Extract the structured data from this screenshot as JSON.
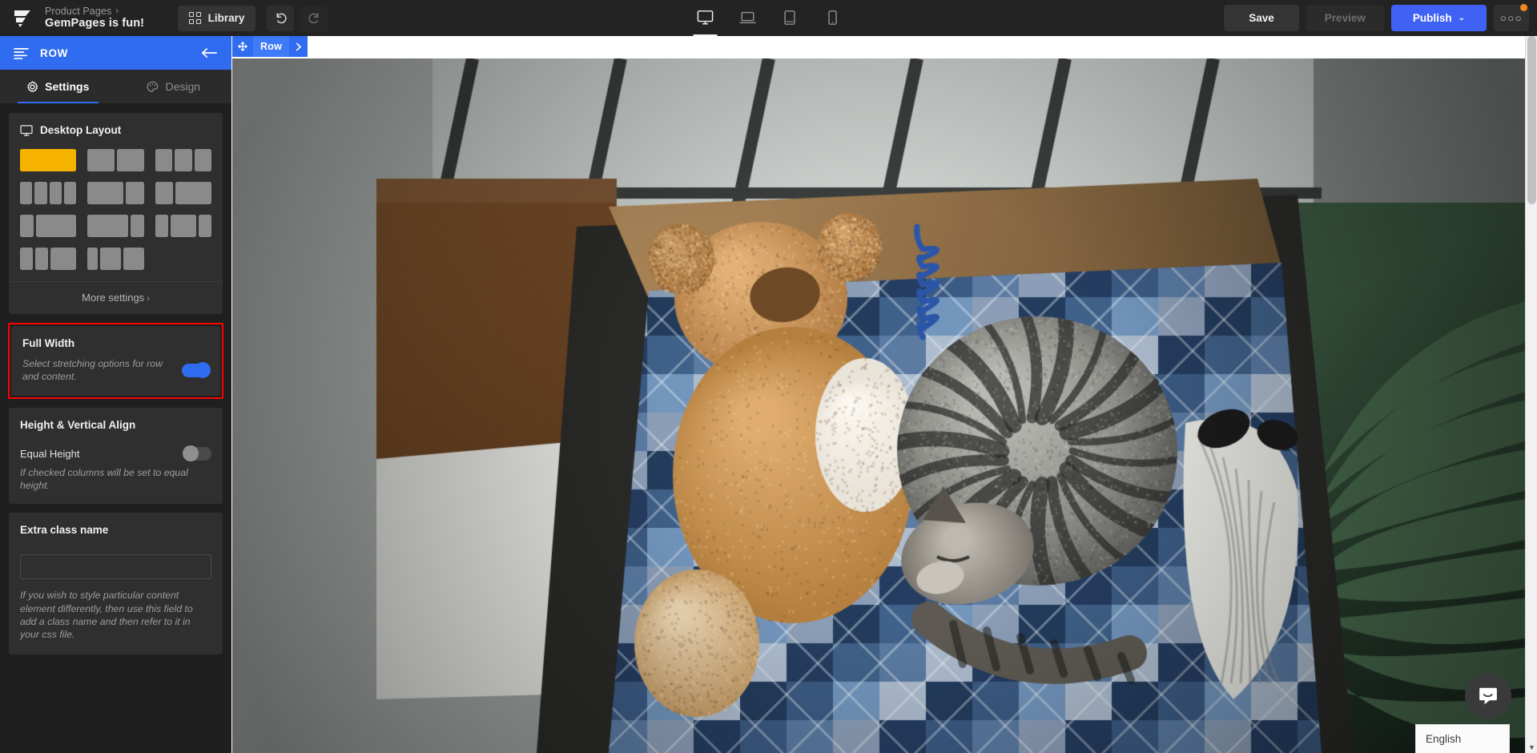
{
  "topbar": {
    "logo_icon": "gempages-logo-icon",
    "breadcrumb_parent": "Product Pages",
    "breadcrumb_chevron": "›",
    "page_title": "GemPages is fun!",
    "library_label": "Library",
    "library_icon": "grid-icon",
    "undo_icon": "undo-icon",
    "redo_icon": "redo-icon",
    "devices": [
      {
        "name": "desktop",
        "icon": "desktop-icon",
        "active": true
      },
      {
        "name": "laptop",
        "icon": "laptop-icon",
        "active": false
      },
      {
        "name": "tablet",
        "icon": "tablet-icon",
        "active": false
      },
      {
        "name": "mobile",
        "icon": "mobile-icon",
        "active": false
      }
    ],
    "save_label": "Save",
    "preview_label": "Preview",
    "publish_label": "Publish",
    "publish_caret": "⌄",
    "more_label": "○○○",
    "accent_blue": "#3f62f5",
    "badge_color": "#f08a1e"
  },
  "sidebar": {
    "header_title": "ROW",
    "header_icon": "rows-layout-icon",
    "back_icon": "arrow-left-icon",
    "header_color": "#2f6cf0",
    "tabs": [
      {
        "label": "Settings",
        "icon": "gear-icon",
        "active": true
      },
      {
        "label": "Design",
        "icon": "palette-icon",
        "active": false
      }
    ],
    "desktop_layout": {
      "title": "Desktop Layout",
      "icon": "monitor-icon",
      "selected_color": "#f5b300",
      "options": [
        {
          "cols": [
            1
          ],
          "selected": true
        },
        {
          "cols": [
            1,
            1
          ],
          "selected": false
        },
        {
          "cols": [
            1,
            1,
            1
          ],
          "selected": false
        },
        {
          "cols": [
            1,
            1,
            1,
            1
          ],
          "selected": false
        },
        {
          "cols": [
            2,
            1
          ],
          "selected": false
        },
        {
          "cols": [
            1,
            2
          ],
          "selected": false
        },
        {
          "cols": [
            1,
            3
          ],
          "selected": false
        },
        {
          "cols": [
            3,
            1
          ],
          "selected": false
        },
        {
          "cols": [
            1,
            2,
            1
          ],
          "selected": false
        },
        {
          "cols": [
            1,
            1,
            2
          ],
          "selected": false
        },
        {
          "cols": [
            1,
            2,
            2
          ],
          "selected": false
        }
      ],
      "more_settings_label": "More settings",
      "more_settings_chevron": "›"
    },
    "full_width": {
      "title": "Full Width",
      "description": "Select stretching options for row and content.",
      "toggle_on": true,
      "highlighted": true,
      "highlight_color": "#ff0000"
    },
    "height_align": {
      "title": "Height & Vertical Align",
      "equal_height_label": "Equal Height",
      "equal_height_on": false,
      "description": "If checked columns will be set to equal height."
    },
    "extra_class": {
      "title": "Extra class name",
      "value": "",
      "placeholder": "",
      "hint": "If you wish to style particular content element differently, then use this field to add a class name and then refer to it in your css file."
    }
  },
  "canvas": {
    "row_tag_label": "Row",
    "row_tag_move_icon": "move-handle-icon",
    "row_tag_arrow_icon": "chevron-right-icon",
    "hero_image_alt": "tabby cat curled asleep on a blue plaid blanket inside a cardboard box next to a tan teddy bear"
  },
  "overlays": {
    "chat_icon": "chat-smile-icon",
    "language_label": "English",
    "language_caret": "⌄",
    "scrollbar_up": "▲",
    "scrollbar_down": "▼"
  }
}
